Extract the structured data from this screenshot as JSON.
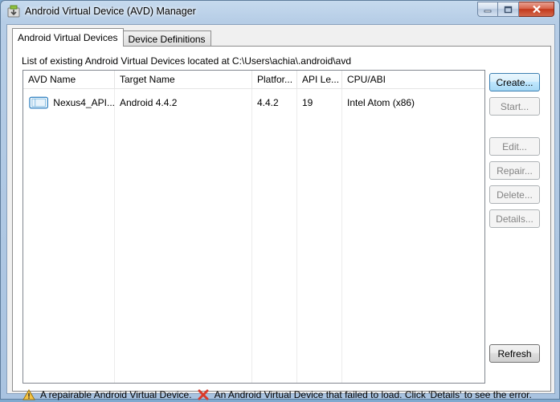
{
  "window": {
    "title": "Android Virtual Device (AVD) Manager"
  },
  "tabs": [
    {
      "label": "Android Virtual Devices",
      "active": true
    },
    {
      "label": "Device Definitions",
      "active": false
    }
  ],
  "panel": {
    "description": "List of existing Android Virtual Devices located at C:\\Users\\achia\\.android\\avd"
  },
  "table": {
    "columns": [
      "AVD Name",
      "Target Name",
      "Platfor...",
      "API Le...",
      "CPU/ABI"
    ],
    "rows": [
      {
        "avd_name": "Nexus4_API...",
        "target_name": "Android 4.4.2",
        "platform": "4.4.2",
        "api_level": "19",
        "cpu_abi": "Intel Atom (x86)",
        "icon": "device-icon"
      }
    ]
  },
  "buttons": {
    "create": "Create...",
    "start": "Start...",
    "edit": "Edit...",
    "repair": "Repair...",
    "delete": "Delete...",
    "details": "Details...",
    "refresh": "Refresh"
  },
  "legend": {
    "warning_text": "A repairable Android Virtual Device.",
    "error_text": "An Android Virtual Device that failed to load. Click 'Details' to see the error.",
    "warning_icon": "warning-icon",
    "error_icon": "error-icon"
  },
  "colors": {
    "title_bar": "#b6cde6",
    "close_button": "#c2391c",
    "primary_button_border": "#3c7fb1"
  }
}
